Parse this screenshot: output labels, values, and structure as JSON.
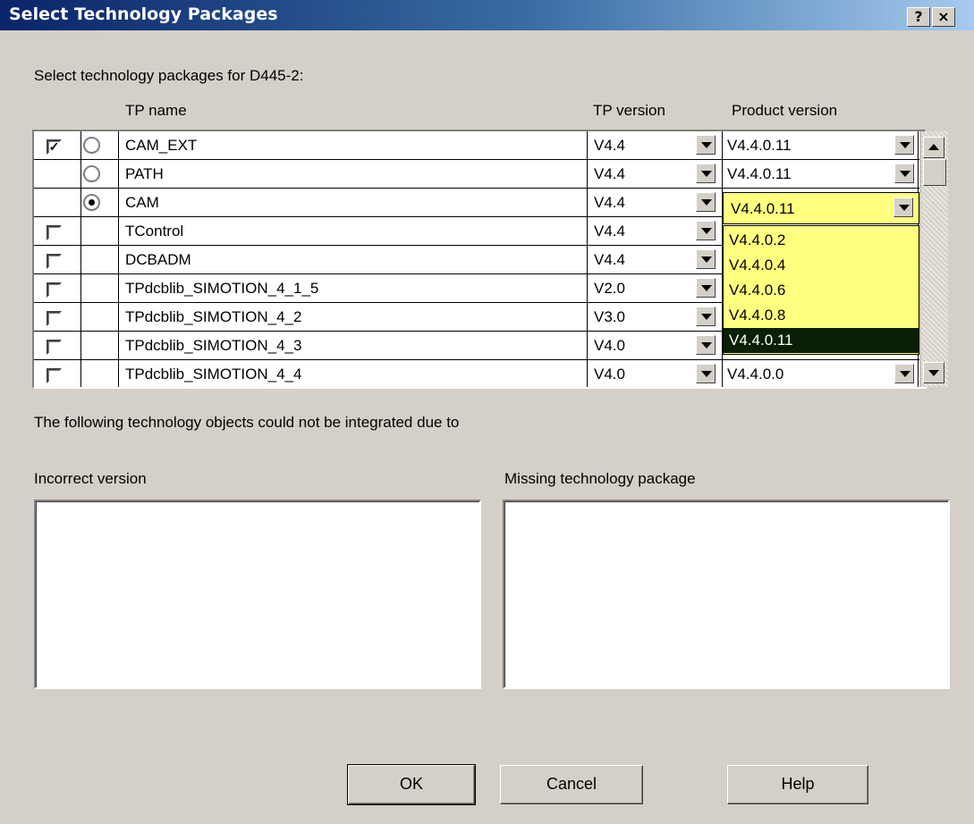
{
  "window": {
    "title": "Select Technology Packages",
    "help_label": "?",
    "close_label": "×"
  },
  "instruction": "Select technology packages for D445-2:",
  "columns": {
    "tp_name": "TP name",
    "tp_version": "TP version",
    "product_version": "Product version"
  },
  "rows": [
    {
      "name": "CAM_EXT",
      "tp_version": "V4.4",
      "product_version": "V4.4.0.11",
      "checkbox": "✓",
      "radio": "unselected"
    },
    {
      "name": "PATH",
      "tp_version": "V4.4",
      "product_version": "V4.4.0.11",
      "checkbox": "",
      "radio": "unselected"
    },
    {
      "name": "CAM",
      "tp_version": "V4.4",
      "product_version": "V4.4.0.11",
      "checkbox": "",
      "radio": "selected"
    },
    {
      "name": "TControl",
      "tp_version": "V4.4",
      "product_version": "",
      "checkbox": "",
      "radio": ""
    },
    {
      "name": "DCBADM",
      "tp_version": "V4.4",
      "product_version": "",
      "checkbox": "",
      "radio": ""
    },
    {
      "name": "TPdcblib_SIMOTION_4_1_5",
      "tp_version": "V2.0",
      "product_version": "",
      "checkbox": "",
      "radio": ""
    },
    {
      "name": "TPdcblib_SIMOTION_4_2",
      "tp_version": "V3.0",
      "product_version": "",
      "checkbox": "",
      "radio": ""
    },
    {
      "name": "TPdcblib_SIMOTION_4_3",
      "tp_version": "V4.0",
      "product_version": "",
      "checkbox": "",
      "radio": ""
    },
    {
      "name": "TPdcblib_SIMOTION_4_4",
      "tp_version": "V4.0",
      "product_version": "V4.4.0.0",
      "checkbox": "",
      "radio": ""
    }
  ],
  "dropdown": {
    "current": "V4.4.0.11",
    "options": [
      "V4.4.0.2",
      "V4.4.0.4",
      "V4.4.0.6",
      "V4.4.0.8",
      "V4.4.0.11"
    ],
    "selected_index": 4,
    "colors": {
      "background": "#ffff80",
      "highlight": "#0a1f05"
    }
  },
  "message": "The following technology objects could not be integrated due to",
  "incorrect_version_label": "Incorrect version",
  "missing_package_label": "Missing technology package",
  "buttons": {
    "ok": "OK",
    "cancel": "Cancel",
    "help": "Help"
  }
}
